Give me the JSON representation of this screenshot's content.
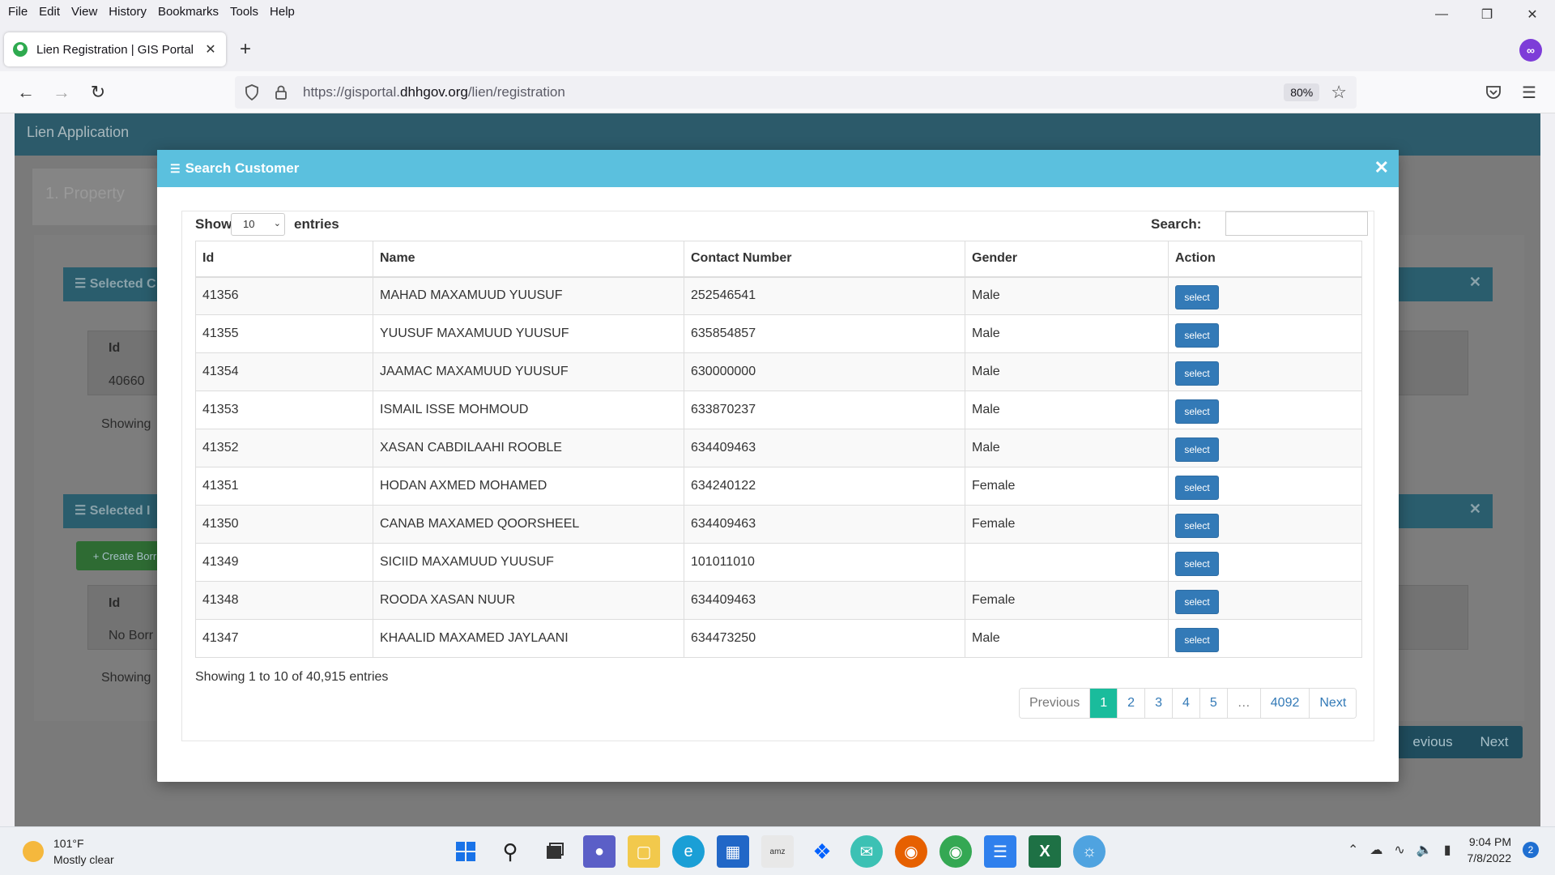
{
  "menu": [
    "File",
    "Edit",
    "View",
    "History",
    "Bookmarks",
    "Tools",
    "Help"
  ],
  "browser": {
    "tab_title": "Lien Registration | GIS Portal",
    "url_prefix": "https://gisportal.",
    "url_domain": "dhhgov.org",
    "url_path": "/lien/registration",
    "zoom": "80%"
  },
  "page": {
    "header_title": "Lien Application",
    "step_label": "1. Property",
    "panel1_title": "Selected C",
    "panel1_id_header": "Id",
    "panel1_id_value": "40660",
    "panel1_showing": "Showing",
    "panel2_title": "Selected I",
    "panel2_create_button": "+ Create Borr",
    "panel2_id_header": "Id",
    "panel2_empty": "No Borr",
    "panel2_showing": "Showing",
    "prev_button": "evious",
    "next_button": "Next"
  },
  "modal": {
    "title": "Search Customer",
    "show_label": "Show",
    "page_size": "10",
    "entries_label": "entries",
    "search_label": "Search:",
    "columns": [
      "Id",
      "Name",
      "Contact Number",
      "Gender",
      "Action"
    ],
    "rows": [
      {
        "id": "41356",
        "name": "MAHAD MAXAMUUD YUUSUF",
        "contact": "252546541",
        "gender": "Male",
        "action": "select"
      },
      {
        "id": "41355",
        "name": "YUUSUF MAXAMUUD YUUSUF",
        "contact": "635854857",
        "gender": "Male",
        "action": "select"
      },
      {
        "id": "41354",
        "name": "JAAMAC MAXAMUUD YUUSUF",
        "contact": "630000000",
        "gender": "Male",
        "action": "select"
      },
      {
        "id": "41353",
        "name": "ISMAIL ISSE MOHMOUD",
        "contact": "633870237",
        "gender": "Male",
        "action": "select"
      },
      {
        "id": "41352",
        "name": "XASAN CABDILAAHI ROOBLE",
        "contact": "634409463",
        "gender": "Male",
        "action": "select"
      },
      {
        "id": "41351",
        "name": "HODAN AXMED MOHAMED",
        "contact": "634240122",
        "gender": "Female",
        "action": "select"
      },
      {
        "id": "41350",
        "name": "CANAB MAXAMED QOORSHEEL",
        "contact": "634409463",
        "gender": "Female",
        "action": "select"
      },
      {
        "id": "41349",
        "name": "SICIID MAXAMUUD YUUSUF",
        "contact": "101011010",
        "gender": "",
        "action": "select"
      },
      {
        "id": "41348",
        "name": "ROODA XASAN NUUR",
        "contact": "634409463",
        "gender": "Female",
        "action": "select"
      },
      {
        "id": "41347",
        "name": "KHAALID MAXAMED JAYLAANI",
        "contact": "634473250",
        "gender": "Male",
        "action": "select"
      }
    ],
    "info": "Showing 1 to 10 of 40,915 entries",
    "pagination": {
      "previous": "Previous",
      "pages": [
        "1",
        "2",
        "3",
        "4",
        "5"
      ],
      "ellipsis": "…",
      "last": "4092",
      "next": "Next",
      "active": "1"
    }
  },
  "taskbar": {
    "temperature": "101°F",
    "weather": "Mostly clear",
    "time": "9:04 PM",
    "date": "7/8/2022",
    "notifications": "2"
  },
  "colors": {
    "modal_header": "#5bc0de",
    "page_header": "#2c5a6a",
    "select_button": "#337ab7",
    "active_page": "#1abc9c"
  }
}
